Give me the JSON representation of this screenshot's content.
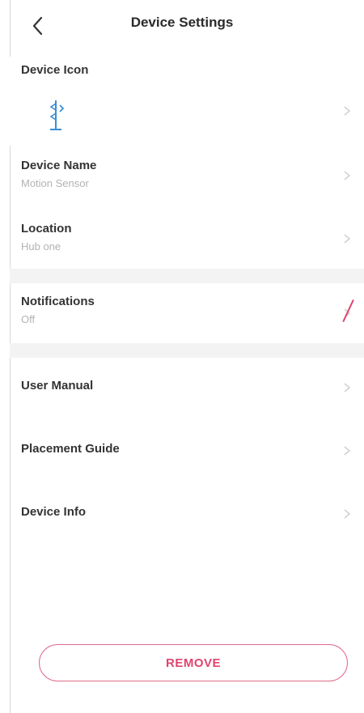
{
  "header": {
    "title": "Device Settings",
    "back_icon": "chevron-left-icon"
  },
  "device_icon": {
    "label": "Device Icon",
    "icon": "motion-sensor-icon"
  },
  "device_name": {
    "label": "Device Name",
    "value": "Motion Sensor"
  },
  "location": {
    "label": "Location",
    "value": "Hub one"
  },
  "notifications": {
    "label": "Notifications",
    "value": "Off"
  },
  "links": {
    "user_manual": "User Manual",
    "placement_guide": "Placement Guide",
    "device_info": "Device Info"
  },
  "remove_label": "REMOVE",
  "colors": {
    "accent": "#e0446f",
    "muted": "#b3b3b3",
    "divider": "#f3f3f3"
  }
}
